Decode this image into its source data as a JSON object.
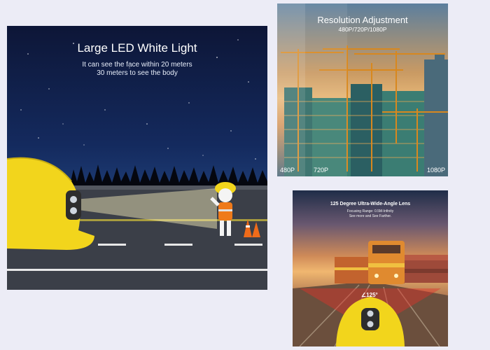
{
  "led_panel": {
    "title": "Large LED White Light",
    "line1": "It can see the face within 20 meters",
    "line2": "30 meters to see the body"
  },
  "resolution_panel": {
    "title": "Resolution Adjustment",
    "subtitle": "480P/720P/1080P",
    "labels": [
      "480P",
      "720P",
      "1080P"
    ]
  },
  "wide_angle_panel": {
    "title": "125 Degree Ultra-Wide-Angle Lens",
    "focus": "Focusing Range:  0.5M-Infinity",
    "tagline": "See more and See Farther.",
    "angle": "∠125°"
  },
  "colors": {
    "helmet": "#f2d51c",
    "sky_night": "#0d1637",
    "sunset": "#e7b777"
  }
}
